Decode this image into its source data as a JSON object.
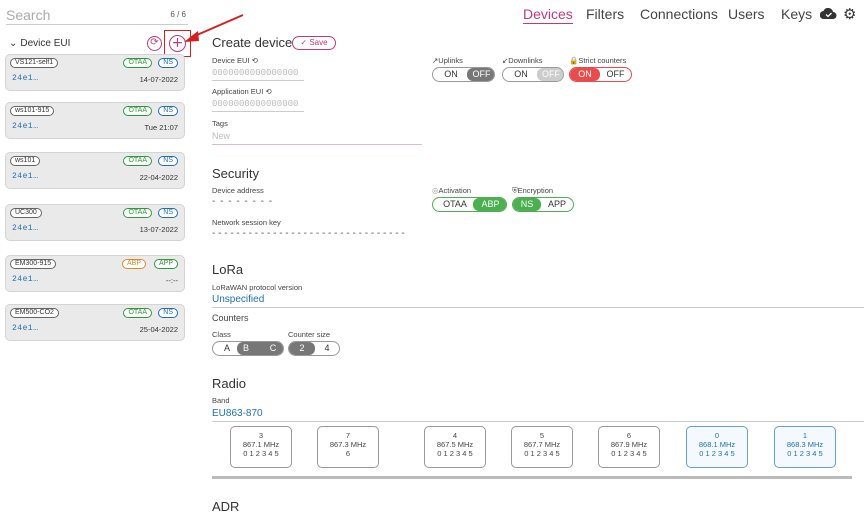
{
  "search": {
    "placeholder": "Search",
    "count": "6 / 6"
  },
  "nav": {
    "devices": "Devices",
    "filters": "Filters",
    "connections": "Connections",
    "users": "Users",
    "keys": "Keys"
  },
  "sidebar": {
    "header": "Device EUI",
    "chevron": "⌄",
    "refresh_icon": "⟳",
    "add_icon": "+",
    "cards": [
      {
        "name": "VS121-self1",
        "badge1": "OTAA",
        "badge2": "NS",
        "eui": "24e1…",
        "date": "14-07-2022"
      },
      {
        "name": "ws101-915",
        "badge1": "OTAA",
        "badge2": "NS",
        "eui": "24e1…",
        "date": "Tue 21:07"
      },
      {
        "name": "ws101",
        "badge1": "OTAA",
        "badge2": "NS",
        "eui": "24e1…",
        "date": "22-04-2022"
      },
      {
        "name": "UC300",
        "badge1": "OTAA",
        "badge2": "NS",
        "eui": "24e1…",
        "date": "13-07-2022"
      },
      {
        "name": "EM300-915",
        "badge1": "ABP",
        "badge2": "APP",
        "eui": "24e1…",
        "date": "--:--"
      },
      {
        "name": "EM500-CO2",
        "badge1": "OTAA",
        "badge2": "NS",
        "eui": "24e1…",
        "date": "25-04-2022"
      }
    ]
  },
  "create": {
    "title": "Create device",
    "save": "✓ Save",
    "dev_eui_label": "Device EUI ⟲",
    "dev_eui": "0000000000000000",
    "app_eui_label": "Application EUI ⟲",
    "app_eui": "0000000000000000",
    "tags_label": "Tags",
    "tags_placeholder": "New",
    "uplinks": "↗Uplinks",
    "downlinks": "↙Downlinks",
    "strict": "🔒Strict counters",
    "on": "ON",
    "off": "OFF"
  },
  "security": {
    "title": "Security",
    "addr_label": "Device address",
    "addr": "- - - - - - - -",
    "activation": "Activation",
    "encryption": "Encryption",
    "otaa": "OTAA",
    "abp": "ABP",
    "ns": "NS",
    "app": "APP",
    "nwk_label": "Network session key",
    "nwk": "- - - - - - - - - - - - - - - - - - - - - - - - - - - - - - - -"
  },
  "lora": {
    "title": "LoRa",
    "version_label": "LoRaWAN protocol version",
    "version": "Unspecified",
    "counters": "Counters",
    "class_label": "Class",
    "counter_label": "Counter size",
    "class_a": "A",
    "class_b": "B",
    "class_c": "C",
    "cs2": "2",
    "cs4": "4"
  },
  "radio": {
    "title": "Radio",
    "band_label": "Band",
    "band": "EU863-870",
    "channels": [
      {
        "n": "3",
        "f": "867.1 MHz",
        "d": "0 1 2 3 4 5"
      },
      {
        "n": "7",
        "f": "867.3 MHz",
        "d": "6"
      },
      {
        "n": "4",
        "f": "867.5 MHz",
        "d": "0 1 2 3 4 5"
      },
      {
        "n": "5",
        "f": "867.7 MHz",
        "d": "0 1 2 3 4 5"
      },
      {
        "n": "6",
        "f": "867.9 MHz",
        "d": "0 1 2 3 4 5"
      },
      {
        "n": "0",
        "f": "868.1 MHz",
        "d": "0 1 2 3 4 5"
      },
      {
        "n": "1",
        "f": "868.3 MHz",
        "d": "0 1 2 3 4 5"
      }
    ]
  },
  "adr": {
    "title": "ADR"
  }
}
